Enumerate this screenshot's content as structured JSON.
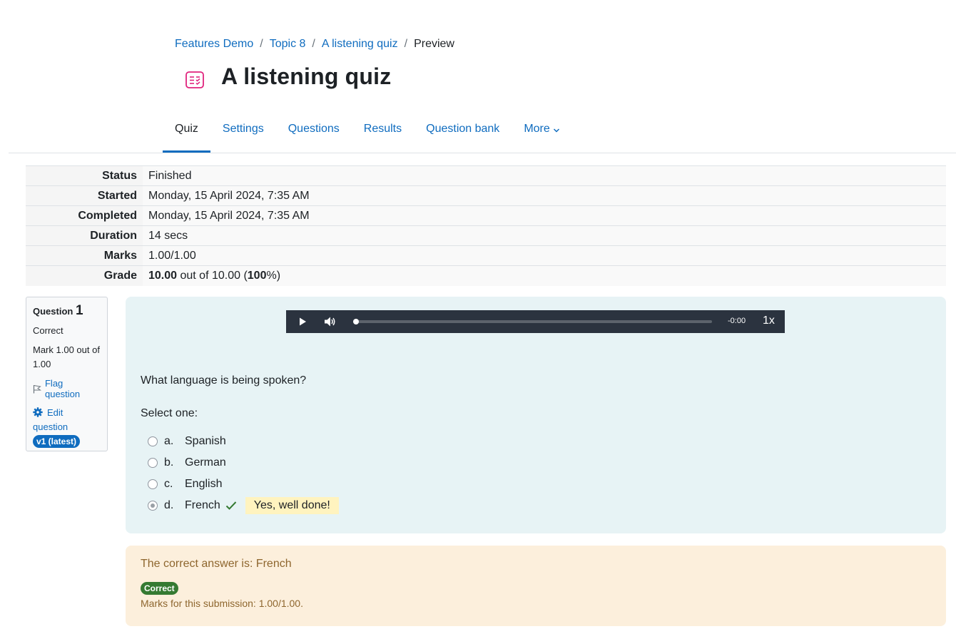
{
  "breadcrumb": {
    "items": [
      "Features Demo",
      "Topic 8",
      "A listening quiz"
    ],
    "current": "Preview",
    "separator": "/"
  },
  "page": {
    "title": "A listening quiz",
    "icon": "quiz-icon",
    "icon_color": "#e0237d"
  },
  "tabs": [
    {
      "label": "Quiz",
      "active": true
    },
    {
      "label": "Settings"
    },
    {
      "label": "Questions"
    },
    {
      "label": "Results"
    },
    {
      "label": "Question bank"
    },
    {
      "label": "More",
      "icon": "chevron-down-icon"
    }
  ],
  "summary": {
    "status": {
      "label": "Status",
      "value": "Finished"
    },
    "started": {
      "label": "Started",
      "value": "Monday, 15 April 2024, 7:35 AM"
    },
    "completed": {
      "label": "Completed",
      "value": "Monday, 15 April 2024, 7:35 AM"
    },
    "duration": {
      "label": "Duration",
      "value": "14 secs"
    },
    "marks": {
      "label": "Marks",
      "value": "1.00/1.00"
    },
    "grade": {
      "label": "Grade",
      "score": "10.00",
      "mid": " out of 10.00 (",
      "percent": "100",
      "end": "%)"
    }
  },
  "question_info": {
    "label": "Question",
    "number": "1",
    "state": "Correct",
    "grade": "Mark 1.00 out of 1.00",
    "flag": "Flag question",
    "edit": "Edit question",
    "version": "v1 (latest)"
  },
  "player": {
    "time": "-0:00",
    "rate": "1x",
    "progress": 0
  },
  "question": {
    "text": "What language is being spoken?",
    "prompt": "Select one:",
    "options": [
      {
        "letter": "a.",
        "label": "Spanish",
        "selected": false
      },
      {
        "letter": "b.",
        "label": "German",
        "selected": false
      },
      {
        "letter": "c.",
        "label": "English",
        "selected": false
      },
      {
        "letter": "d.",
        "label": "French",
        "selected": true
      }
    ],
    "feedback": "Yes, well done!"
  },
  "outcome": {
    "right_answer": "The correct answer is: French",
    "badge": "Correct",
    "marks": "Marks for this submission: 1.00/1.00."
  },
  "colors": {
    "link": "#0f6cbf",
    "question_bg": "#e7f3f5",
    "outcome_bg": "#fcefdc",
    "correct": "#357a32",
    "feedback_bg": "#fff3bf",
    "player_bg": "#2b333f"
  }
}
